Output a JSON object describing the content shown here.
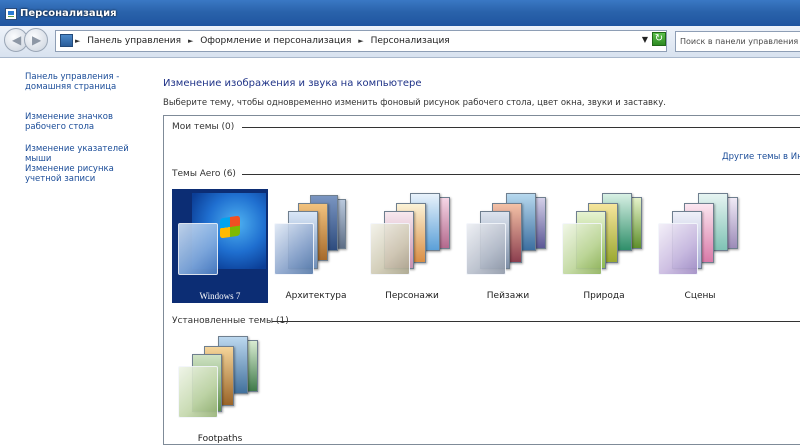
{
  "window": {
    "title": "Персонализация"
  },
  "toolbar": {
    "breadcrumbs": [
      "Панель управления",
      "Оформление и персонализация",
      "Персонализация"
    ],
    "search_placeholder": "Поиск в панели управления"
  },
  "sidebar": {
    "links": [
      "Панель управления - домашняя страница",
      "Изменение значков рабочего стола",
      "Изменение указателей мыши",
      "Изменение рисунка учетной записи"
    ]
  },
  "main": {
    "title": "Изменение изображения и звука на компьютере",
    "description": "Выберите тему, чтобы одновременно изменить фоновый рисунок рабочего стола, цвет окна, звуки и заставку.",
    "groups": {
      "my": "Мои темы (0)",
      "aero": "Темы Aero (6)",
      "installed": "Установленные темы (1)"
    },
    "online_link": "Другие темы в Интернете",
    "aero_themes": [
      "Windows 7",
      "Архитектура",
      "Персонажи",
      "Пейзажи",
      "Природа",
      "Сцены"
    ],
    "installed_themes": [
      "Footpaths"
    ],
    "selected_theme": "Windows 7"
  }
}
